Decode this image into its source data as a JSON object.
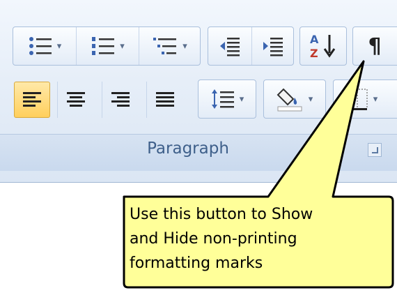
{
  "ribbon": {
    "group_label": "Paragraph",
    "row1": [
      {
        "name": "bullets-button",
        "icon": "bullets-icon",
        "dropdown": true
      },
      {
        "name": "numbering-button",
        "icon": "numbering-icon",
        "dropdown": true
      },
      {
        "name": "multilevel-list-button",
        "icon": "multilevel-list-icon",
        "dropdown": true
      },
      {
        "name": "decrease-indent-button",
        "icon": "decrease-indent-icon"
      },
      {
        "name": "increase-indent-button",
        "icon": "increase-indent-icon"
      },
      {
        "name": "sort-button",
        "icon": "sort-icon"
      },
      {
        "name": "show-hide-button",
        "icon": "pilcrow-icon"
      }
    ],
    "row2": [
      {
        "name": "align-left-button",
        "icon": "align-left-icon",
        "active": true
      },
      {
        "name": "center-button",
        "icon": "center-icon"
      },
      {
        "name": "align-right-button",
        "icon": "align-right-icon"
      },
      {
        "name": "justify-button",
        "icon": "justify-icon"
      },
      {
        "name": "line-spacing-button",
        "icon": "line-spacing-icon",
        "dropdown": true
      },
      {
        "name": "shading-button",
        "icon": "shading-icon",
        "dropdown": true
      },
      {
        "name": "borders-button",
        "icon": "borders-icon",
        "dropdown": true
      }
    ],
    "colors": {
      "accent": "#ffcf5c",
      "ribbon_bg": "#dbe6f4",
      "label": "#3e5f8a"
    }
  },
  "callout": {
    "text": "Use this button to Show\nand Hide non-printing\nformatting marks",
    "fill": "#ffff99"
  },
  "icons": {
    "sort_letters_top": "A",
    "sort_letters_bottom": "Z",
    "pilcrow": "¶"
  }
}
